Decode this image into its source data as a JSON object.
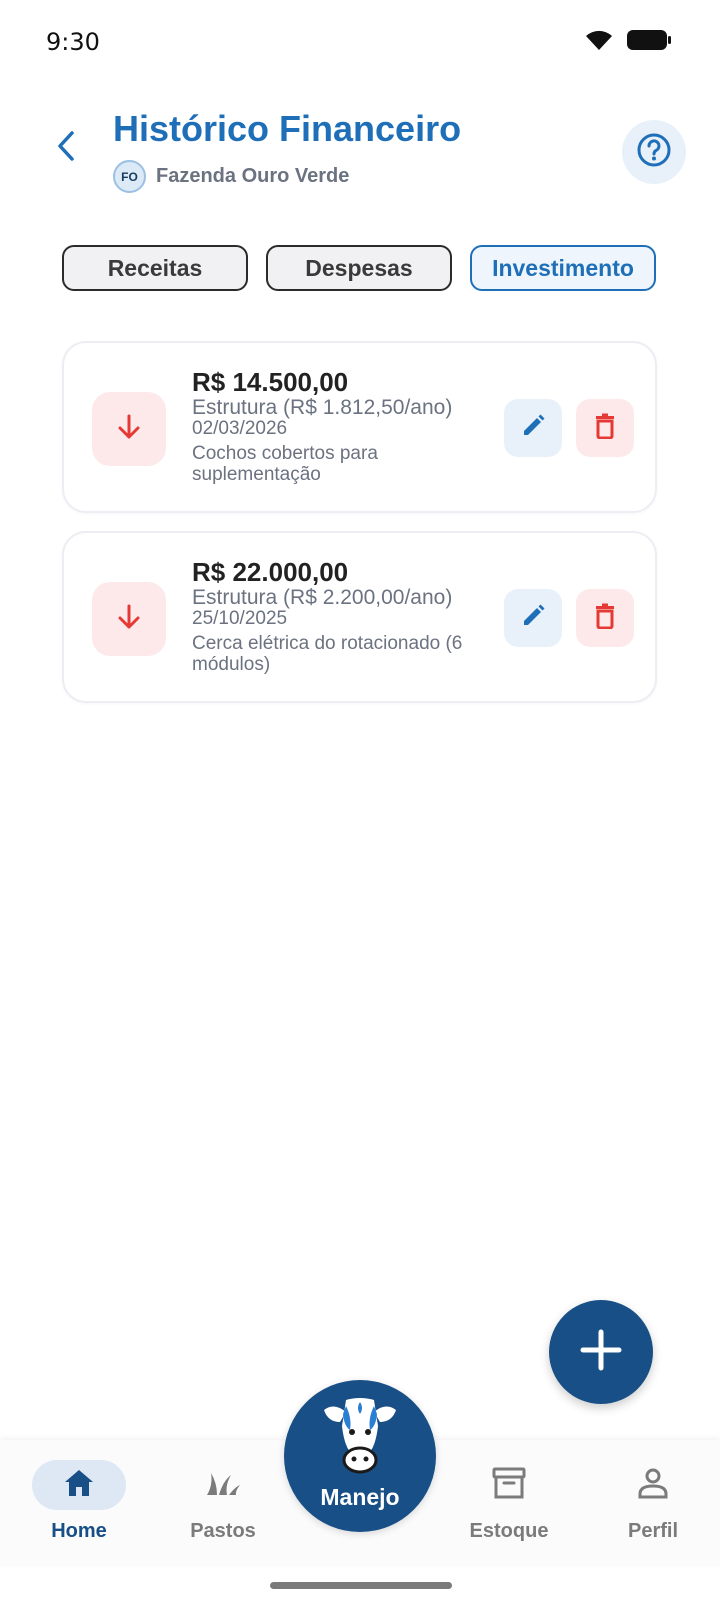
{
  "status_bar": {
    "time": "9:30"
  },
  "header": {
    "title": "Histórico Financeiro",
    "farm_initials": "FO",
    "farm_name": "Fazenda Ouro Verde"
  },
  "tabs": [
    {
      "label": "Receitas",
      "active": false
    },
    {
      "label": "Despesas",
      "active": false
    },
    {
      "label": "Investimento",
      "active": true
    }
  ],
  "entries": [
    {
      "amount": "R$ 14.500,00",
      "category": "Estrutura (R$ 1.812,50/ano)",
      "date": "02/03/2026",
      "description": "Cochos cobertos para suplementação",
      "direction_icon": "arrow-down-icon"
    },
    {
      "amount": "R$ 22.000,00",
      "category": "Estrutura (R$ 2.200,00/ano)",
      "date": "25/10/2025",
      "description": "Cerca elétrica do rotacionado (6 módulos)",
      "direction_icon": "arrow-down-icon"
    }
  ],
  "bottom_nav": {
    "items": [
      {
        "label": "Home",
        "icon": "home-icon",
        "active": true
      },
      {
        "label": "Pastos",
        "icon": "grass-icon",
        "active": false
      },
      {
        "label": "Estoque",
        "icon": "archive-icon",
        "active": false
      },
      {
        "label": "Perfil",
        "icon": "person-icon",
        "active": false
      }
    ],
    "center": {
      "label": "Manejo",
      "icon": "cow-icon"
    }
  },
  "colors": {
    "primary": "#1e6fb8",
    "dark_primary": "#174f86",
    "danger": "#e53935",
    "danger_bg": "#fde9ea",
    "muted_text": "#6b7280"
  }
}
